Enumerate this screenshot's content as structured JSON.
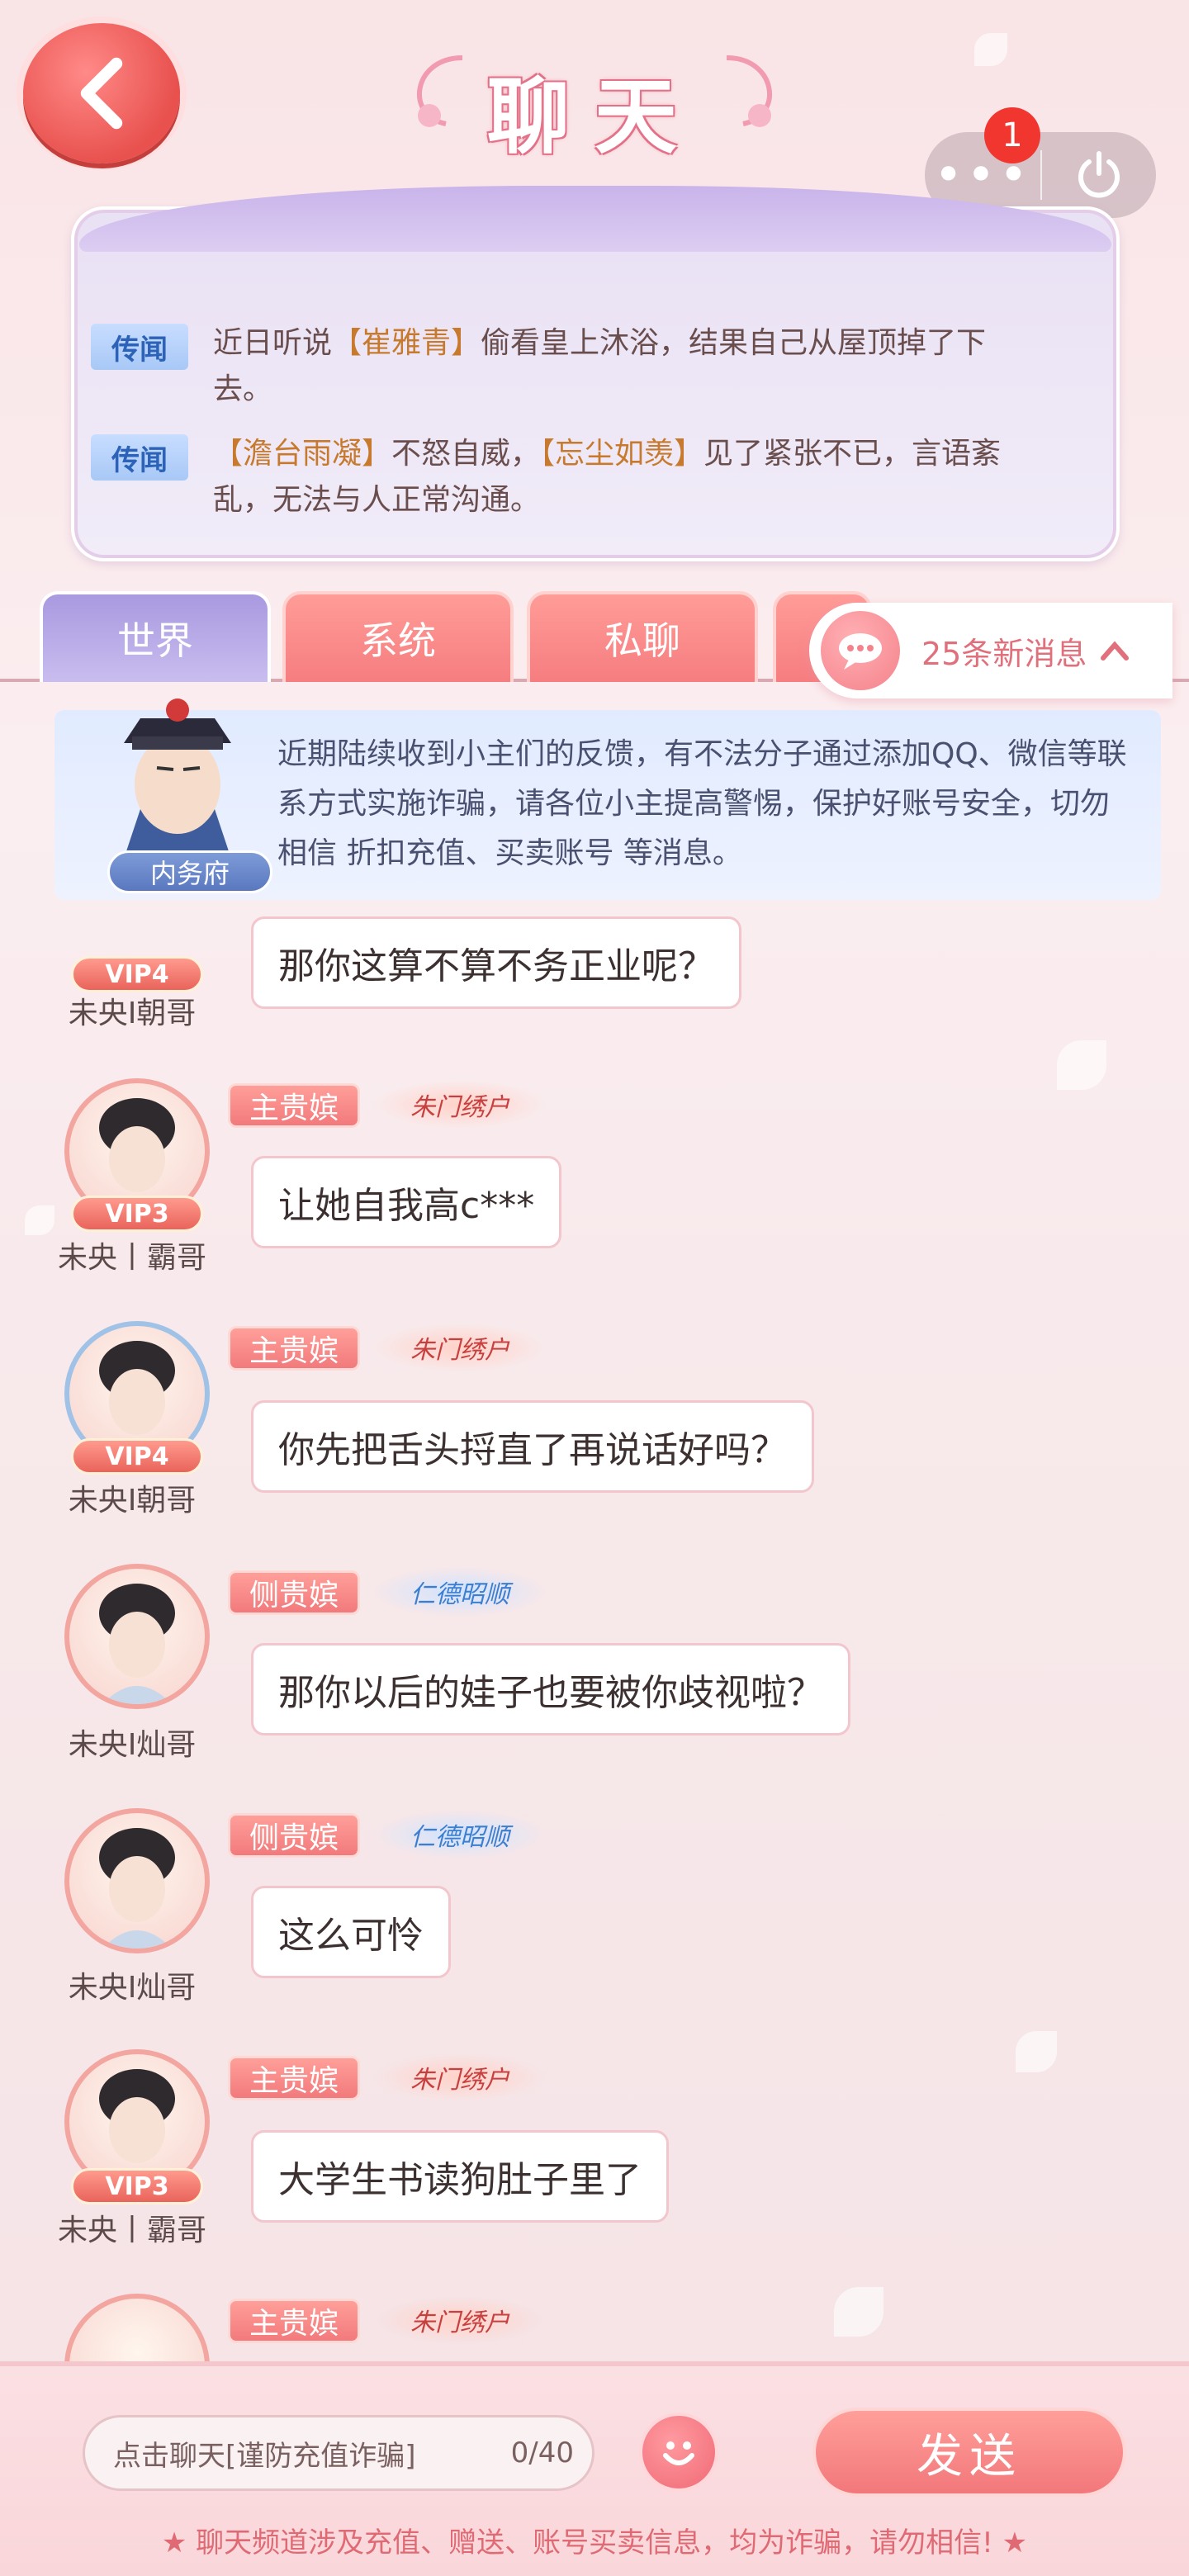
{
  "header": {
    "title": "聊天",
    "back_icon": "chevron-left-icon",
    "more_label": "•••",
    "notification_count": "1",
    "power_icon": "power-icon"
  },
  "rumors": [
    {
      "tag": "传闻",
      "prefix": "近日听说",
      "name": "【崔雅青】",
      "suffix": "偷看皇上沐浴，结果自己从屋顶掉了下去。"
    },
    {
      "tag": "传闻",
      "prefix": "",
      "name": "【澹台雨凝】",
      "middle": "不怒自威，",
      "name2": "【忘尘如羡】",
      "suffix": "见了紧张不已，言语紊乱，无法与人正常沟通。"
    }
  ],
  "tabs": [
    {
      "label": "世界",
      "active": true
    },
    {
      "label": "系统",
      "active": false
    },
    {
      "label": "私聊",
      "active": false
    }
  ],
  "new_messages": "25条新消息",
  "notice": {
    "label": "内务府",
    "text": "近期陆续收到小主们的反馈，有不法分子通过添加QQ、微信等联系方式实施诈骗，请各位小主提高警惕，保护好账号安全，切勿相信 折扣充值、买卖账号 等消息。"
  },
  "messages": [
    {
      "user": "未央Ι朝哥",
      "vip": "VIP4",
      "rank": "",
      "title": "",
      "text": "那你这算不算不务正业呢？"
    },
    {
      "user": "未央丨霸哥",
      "vip": "VIP3",
      "rank": "主贵嫔",
      "title": "朱门绣户",
      "text": "让她自我高c***"
    },
    {
      "user": "未央Ι朝哥",
      "vip": "VIP4",
      "rank": "主贵嫔",
      "title": "朱门绣户",
      "text": "你先把舌头捋直了再说话好吗？"
    },
    {
      "user": "未央Ι灿哥",
      "vip": "",
      "rank": "侧贵嫔",
      "title": "仁德昭顺",
      "text": "那你以后的娃子也要被你歧视啦？"
    },
    {
      "user": "未央Ι灿哥",
      "vip": "",
      "rank": "侧贵嫔",
      "title": "仁德昭顺",
      "text": "这么可怜"
    },
    {
      "user": "未央丨霸哥",
      "vip": "VIP3",
      "rank": "主贵嫔",
      "title": "朱门绣户",
      "text": "大学生书读狗肚子里了"
    },
    {
      "user": "",
      "vip": "",
      "rank": "主贵嫔",
      "title": "朱门绣户",
      "text": ""
    }
  ],
  "footer": {
    "input_placeholder": "点击聊天[谨防充值诈骗]",
    "input_counter": "0/40",
    "send_label": "发送",
    "warning": "聊天频道涉及充值、赠送、账号买卖信息，均为诈骗，请勿相信!"
  },
  "colors": {
    "accent_red": "#f2777b",
    "tab_active": "#a999e0",
    "rumor_tag": "#2c63b8"
  }
}
